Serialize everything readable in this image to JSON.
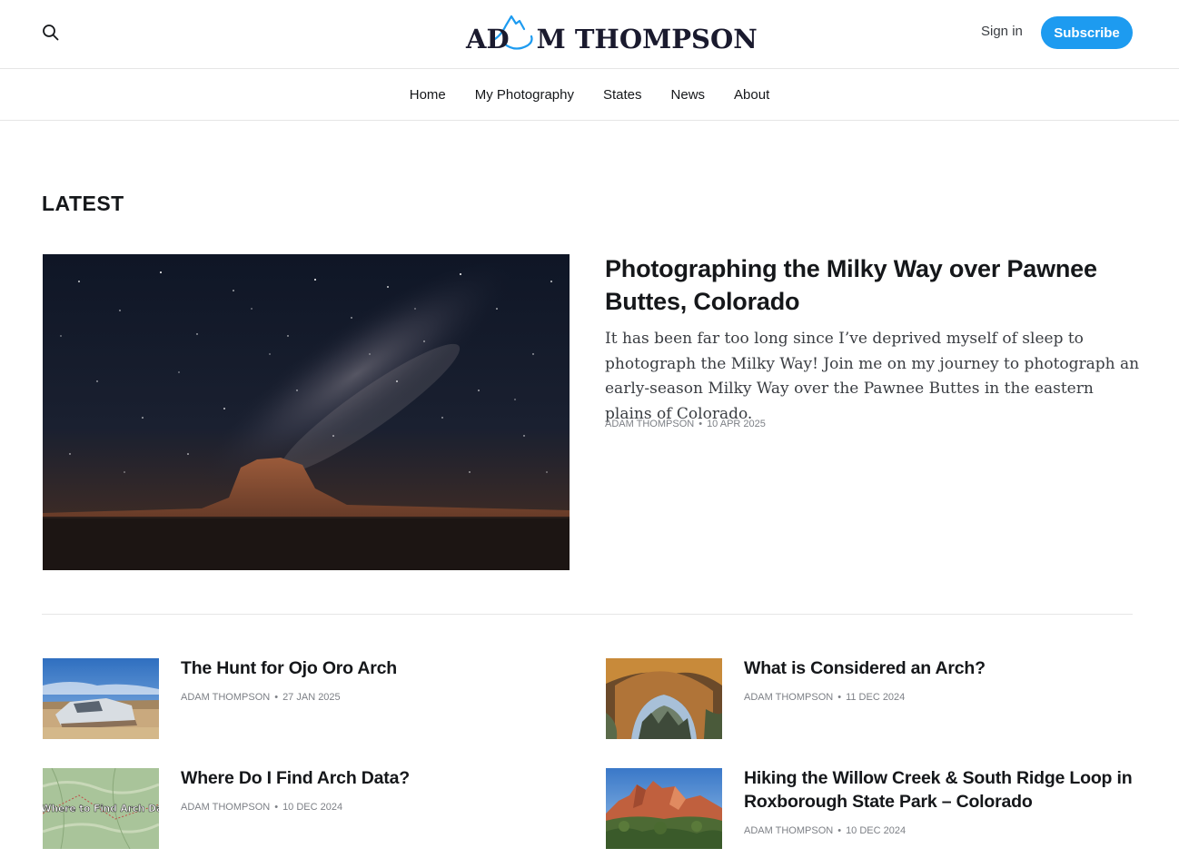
{
  "header": {
    "logo_text_left": "AD",
    "logo_text_right": "M THOMPSON",
    "logo_accent": "#1d9bf0",
    "signin_label": "Sign in",
    "subscribe_label": "Subscribe",
    "subscribe_color": "#1d9bf0"
  },
  "nav": {
    "items": [
      {
        "label": "Home"
      },
      {
        "label": "My Photography"
      },
      {
        "label": "States"
      },
      {
        "label": "News"
      },
      {
        "label": "About"
      }
    ]
  },
  "section": {
    "title": "LATEST"
  },
  "featured": {
    "title": "Photographing the Milky Way over Pawnee Buttes, Colorado",
    "excerpt": "It has been far too long since I’ve deprived myself of sleep to photograph the Milky Way! Join me on my journey to photograph an early-season Milky Way over the Pawnee Buttes in the eastern plains of Colorado.",
    "author": "ADAM THOMPSON",
    "date": "10 APR 2025"
  },
  "posts": [
    {
      "title": "The Hunt for Ojo Oro Arch",
      "author": "ADAM THOMPSON",
      "date": "27 JAN 2025"
    },
    {
      "title": "What is Considered an Arch?",
      "author": "ADAM THOMPSON",
      "date": "11 DEC 2024"
    },
    {
      "title": "Where Do I Find Arch Data?",
      "author": "ADAM THOMPSON",
      "date": "10 DEC 2024",
      "thumb_text": "Where to Find Arch Data"
    },
    {
      "title": "Hiking the Willow Creek & South Ridge Loop in Roxborough State Park – Colorado",
      "author": "ADAM THOMPSON",
      "date": "10 DEC 2024"
    }
  ]
}
